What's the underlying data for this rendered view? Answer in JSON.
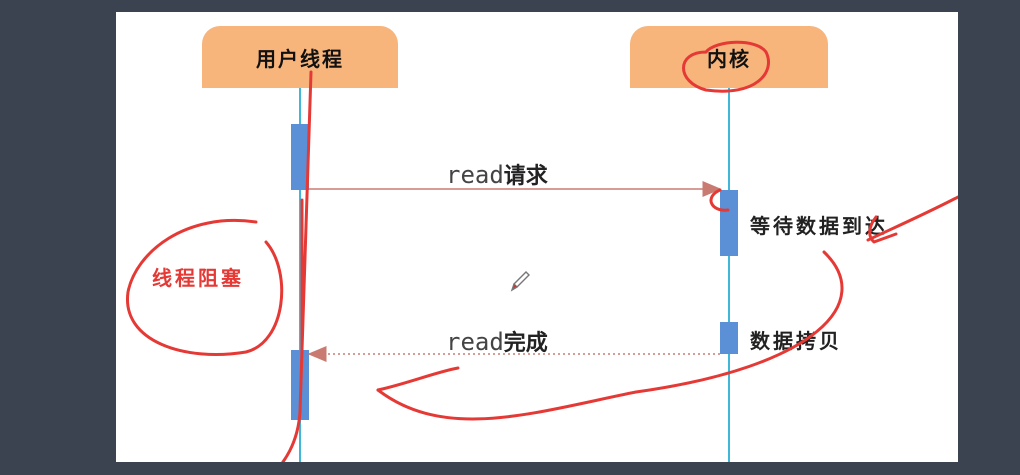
{
  "actors": {
    "left": "用户线程",
    "right": "内核"
  },
  "messages": {
    "request": {
      "code": "read",
      "text": "请求"
    },
    "complete": {
      "code": "read",
      "text": "完成"
    }
  },
  "notes": {
    "wait": "等待数据到达",
    "copy": "数据拷贝"
  },
  "annotations": {
    "blocked": "线程阻塞"
  },
  "colors": {
    "actor_box": "#f7b57c",
    "lifeline": "#3fb7d9",
    "activation": "#5b8fd6",
    "arrow": "#c97b72",
    "ink": "#e53935",
    "background": "#3b4350"
  }
}
